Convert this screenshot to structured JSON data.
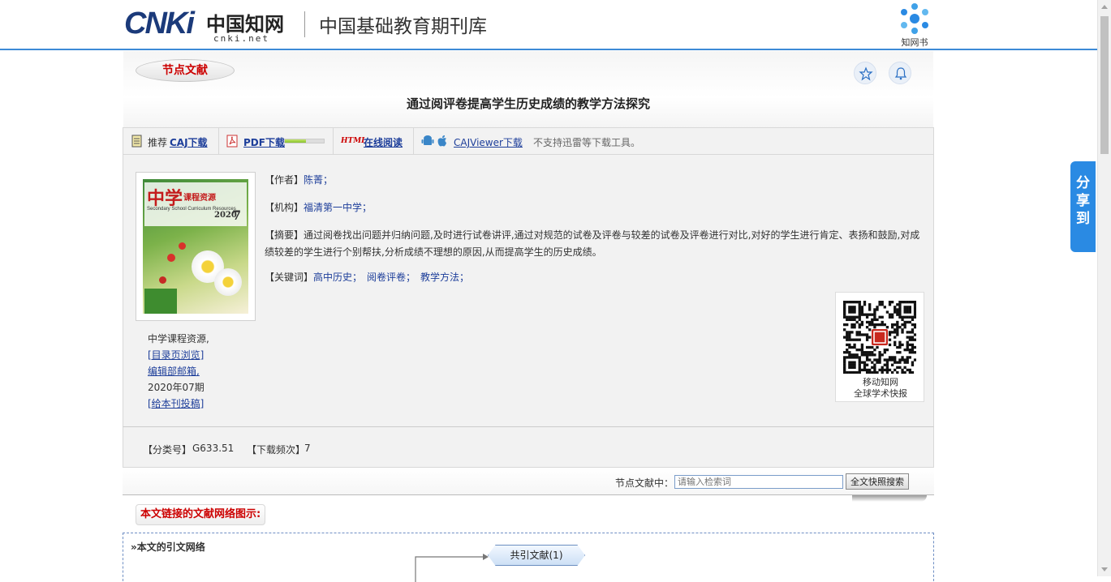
{
  "header": {
    "logo_cn": "CNKi",
    "logo_zh": "中国知网",
    "logo_net": "cnki.net",
    "title": "中国基础教育期刊库",
    "zwb_label": "知网书"
  },
  "share_label": [
    "分",
    "享",
    "到"
  ],
  "article": {
    "badge": "节点文献",
    "title": "通过阅评卷提高学生历史成绩的教学方法探究"
  },
  "download_bar": {
    "recommend": "推荐",
    "caj": "CAJ下载",
    "pdf": "PDF下载",
    "html_icon": "HTML",
    "html_read": "在线阅读",
    "cajviewer": "CAJViewer下载",
    "note": "不支持迅雷等下载工具。"
  },
  "cover": {
    "t1": "中学",
    "t2": "课程资源",
    "t3": "Secondary School Curriculum Resources",
    "t4": "2020",
    "t5": "7"
  },
  "journal": {
    "name": "中学课程资源,",
    "browse": "[目录页浏览]",
    "editor": "编辑部邮箱,",
    "issue": "2020年07期",
    "submit": "[给本刊投稿]"
  },
  "fields": {
    "author_key": "【作者】",
    "author": "陈菁；",
    "org_key": "【机构】",
    "org": "福清第一中学；",
    "abstract_key": "【摘要】",
    "abstract": "通过阅卷找出问题并归纳问题,及时进行试卷讲评,通过对规范的试卷及评卷与较差的试卷及评卷进行对比,对好的学生进行肯定、表扬和鼓励,对成绩较差的学生进行个别帮扶,分析成绩不理想的原因,从而提高学生的历史成绩。",
    "kw_key": "【关键词】",
    "keywords": [
      "高中历史；",
      "阅卷评卷；",
      "教学方法；"
    ]
  },
  "qr": {
    "line1": "移动知网",
    "line2": "全球学术快报"
  },
  "classification": {
    "cls_key": "【分类号】",
    "cls": "G633.51",
    "dl_key": "【下载频次】",
    "dl": "7"
  },
  "search": {
    "label": "节点文献中：",
    "placeholder": "请输入检索词",
    "button": "全文快照搜索"
  },
  "network": {
    "title": "本文链接的文献网络图示:",
    "header": "»本文的引文网络",
    "node": "共引文献(1)"
  },
  "pdf_progress": 0.55
}
